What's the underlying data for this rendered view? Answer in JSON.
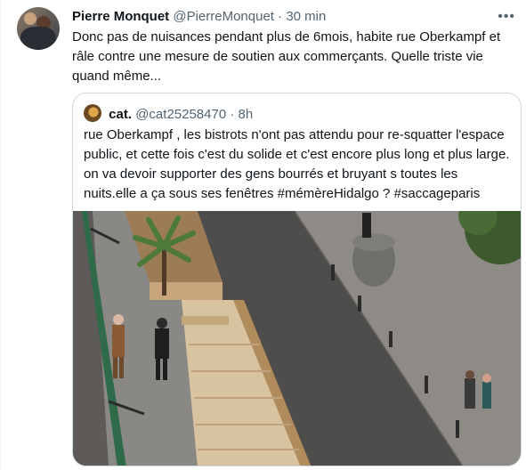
{
  "tweet": {
    "author_name": "Pierre Monquet",
    "author_handle": "@PierreMonquet",
    "separator": "·",
    "time": "30 min",
    "more_icon": "more-dots-icon",
    "text": "Donc pas de nuisances pendant plus de 6mois, habite rue Oberkampf et râle contre une mesure de soutien aux commerçants. Quelle triste vie quand même..."
  },
  "quoted_tweet": {
    "author_name": "cat.",
    "author_handle": "@cat25258470",
    "separator": "·",
    "time": "8h",
    "text": "rue Oberkampf , les bistrots n'ont pas attendu pour re-squatter l'espace public, et cette fois c'est du solide et c'est encore plus long et plus large. on va devoir supporter des gens bourrés et bruyant s toutes les nuits.elle a ça sous ses fenêtres #mémèreHidalgo ? #saccageparis"
  }
}
